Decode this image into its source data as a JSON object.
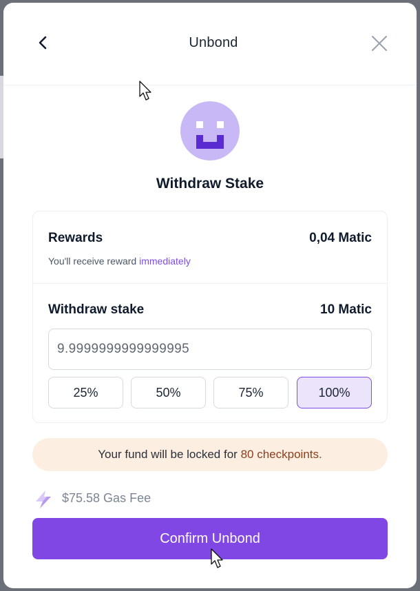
{
  "modal": {
    "title": "Unbond",
    "heading": "Withdraw Stake"
  },
  "rewards": {
    "label": "Rewards",
    "value": "0,04 Matic",
    "note_prefix": "You'll receive reward",
    "note_accent": "immediately"
  },
  "withdraw": {
    "label": "Withdraw stake",
    "value": "10 Matic",
    "input_value": "9.9999999999999995",
    "percent_options": [
      "25%",
      "50%",
      "75%",
      "100%"
    ],
    "selected_percent": "100%"
  },
  "lock_notice": {
    "prefix": "Your fund will be locked for",
    "checkpoints": "80 checkpoints."
  },
  "gas": {
    "text": "$75.58 Gas Fee"
  },
  "confirm_button": {
    "label": "Confirm Unbond"
  },
  "colors": {
    "accent": "#8147e4",
    "accent_light": "#ece4fb",
    "banner_bg": "#fdeee2",
    "avatar_bg": "#c9b8f6"
  }
}
